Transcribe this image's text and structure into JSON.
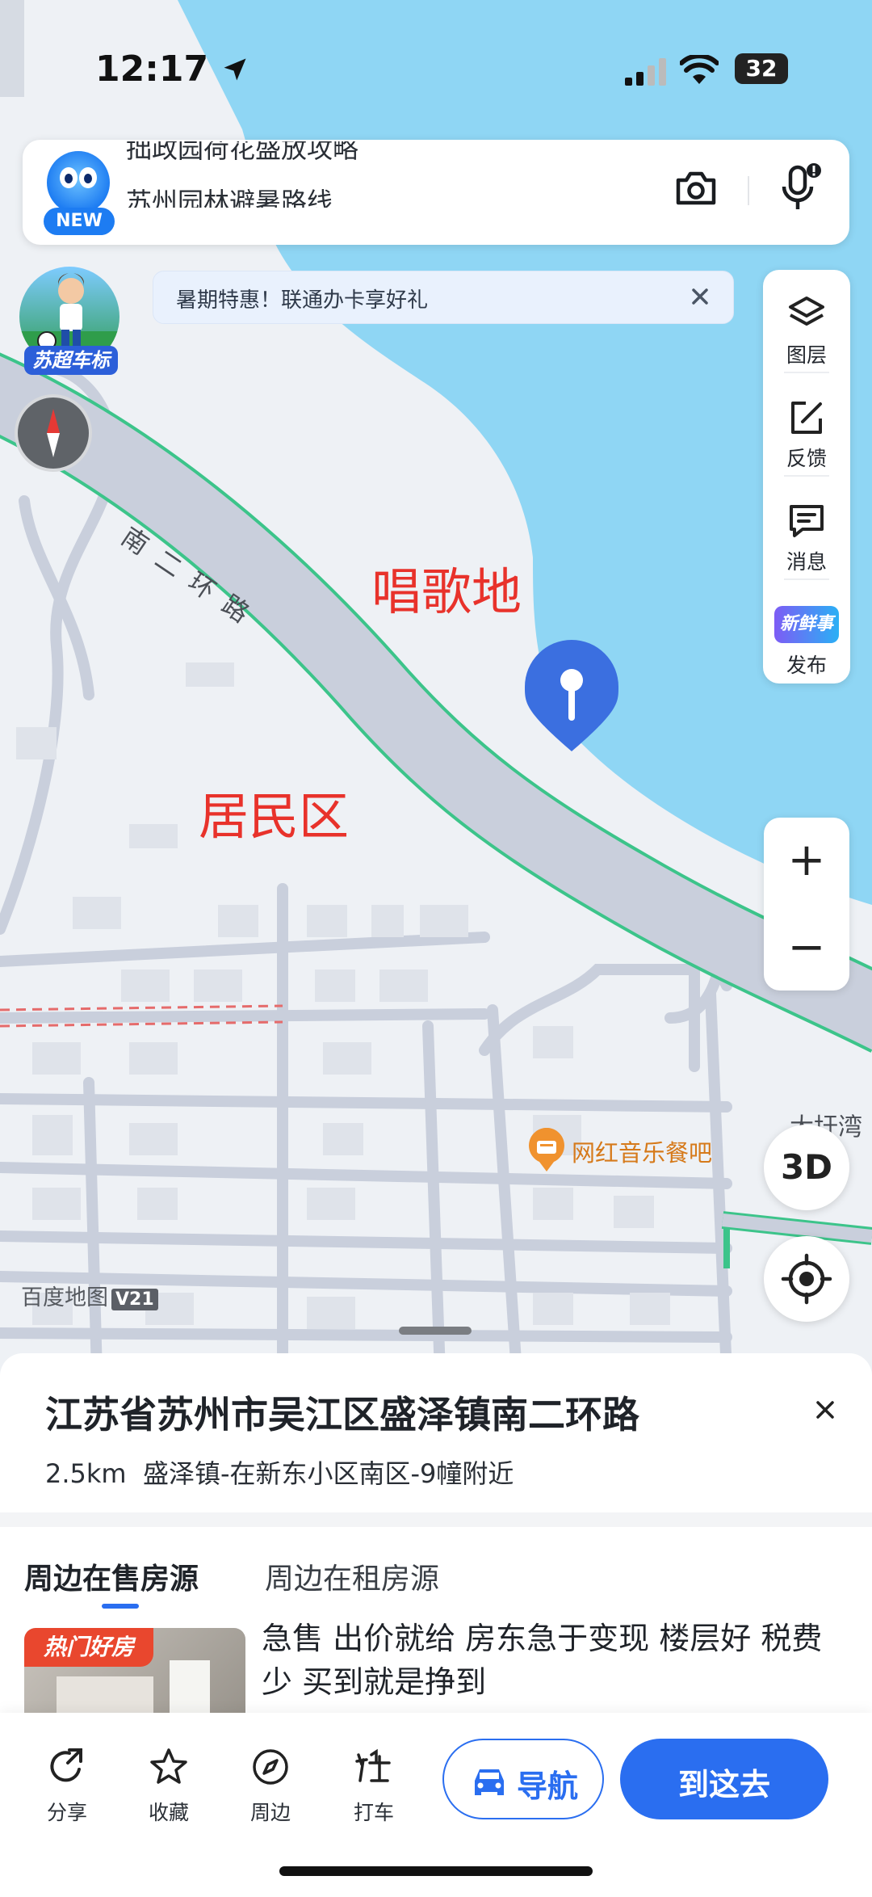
{
  "status_bar": {
    "time": "12:17",
    "battery": "32"
  },
  "search": {
    "logo_tag": "NEW",
    "suggestion_top": "拙政园荷花盛放攻略",
    "suggestion_main": "苏州园林避暑路线"
  },
  "promo": {
    "text": "暑期特惠！联通办卡享好礼"
  },
  "badge": {
    "label": "苏超车标"
  },
  "toolbar": {
    "layers": "图层",
    "feedback": "反馈",
    "messages": "消息",
    "publish": "发布",
    "publish_art": "新鲜事"
  },
  "map": {
    "road_name": "南二环路",
    "annotation_sing": "唱歌地",
    "annotation_residential": "居民区",
    "poi_name": "网红音乐餐吧",
    "place_name": "大圩湾",
    "watermark": "百度地图",
    "watermark_tag": "V21",
    "btn_3d": "3D",
    "zoom_in": "+",
    "zoom_out": "−"
  },
  "card": {
    "address": "江苏省苏州市吴江区盛泽镇南二环路",
    "distance": "2.5km",
    "near": "盛泽镇-在新东小区南区-9幢附近",
    "tabs": [
      "周边在售房源",
      "周边在租房源"
    ],
    "listing_badge": "热门好房",
    "listing_title": "急售 出价就给 房东急于变现 楼层好 税费少 买到就是挣到"
  },
  "actions": {
    "share": "分享",
    "favorite": "收藏",
    "nearby": "周边",
    "taxi": "打车",
    "navigate": "导航",
    "go_here": "到这去"
  },
  "colors": {
    "water": "#8fd6f4",
    "land": "#eef1f5",
    "road": "#c9cfdc",
    "road_edge": "#3cc48a",
    "accent": "#2a6ef0",
    "poi": "#d67a1b",
    "annotation": "#e8322b"
  }
}
